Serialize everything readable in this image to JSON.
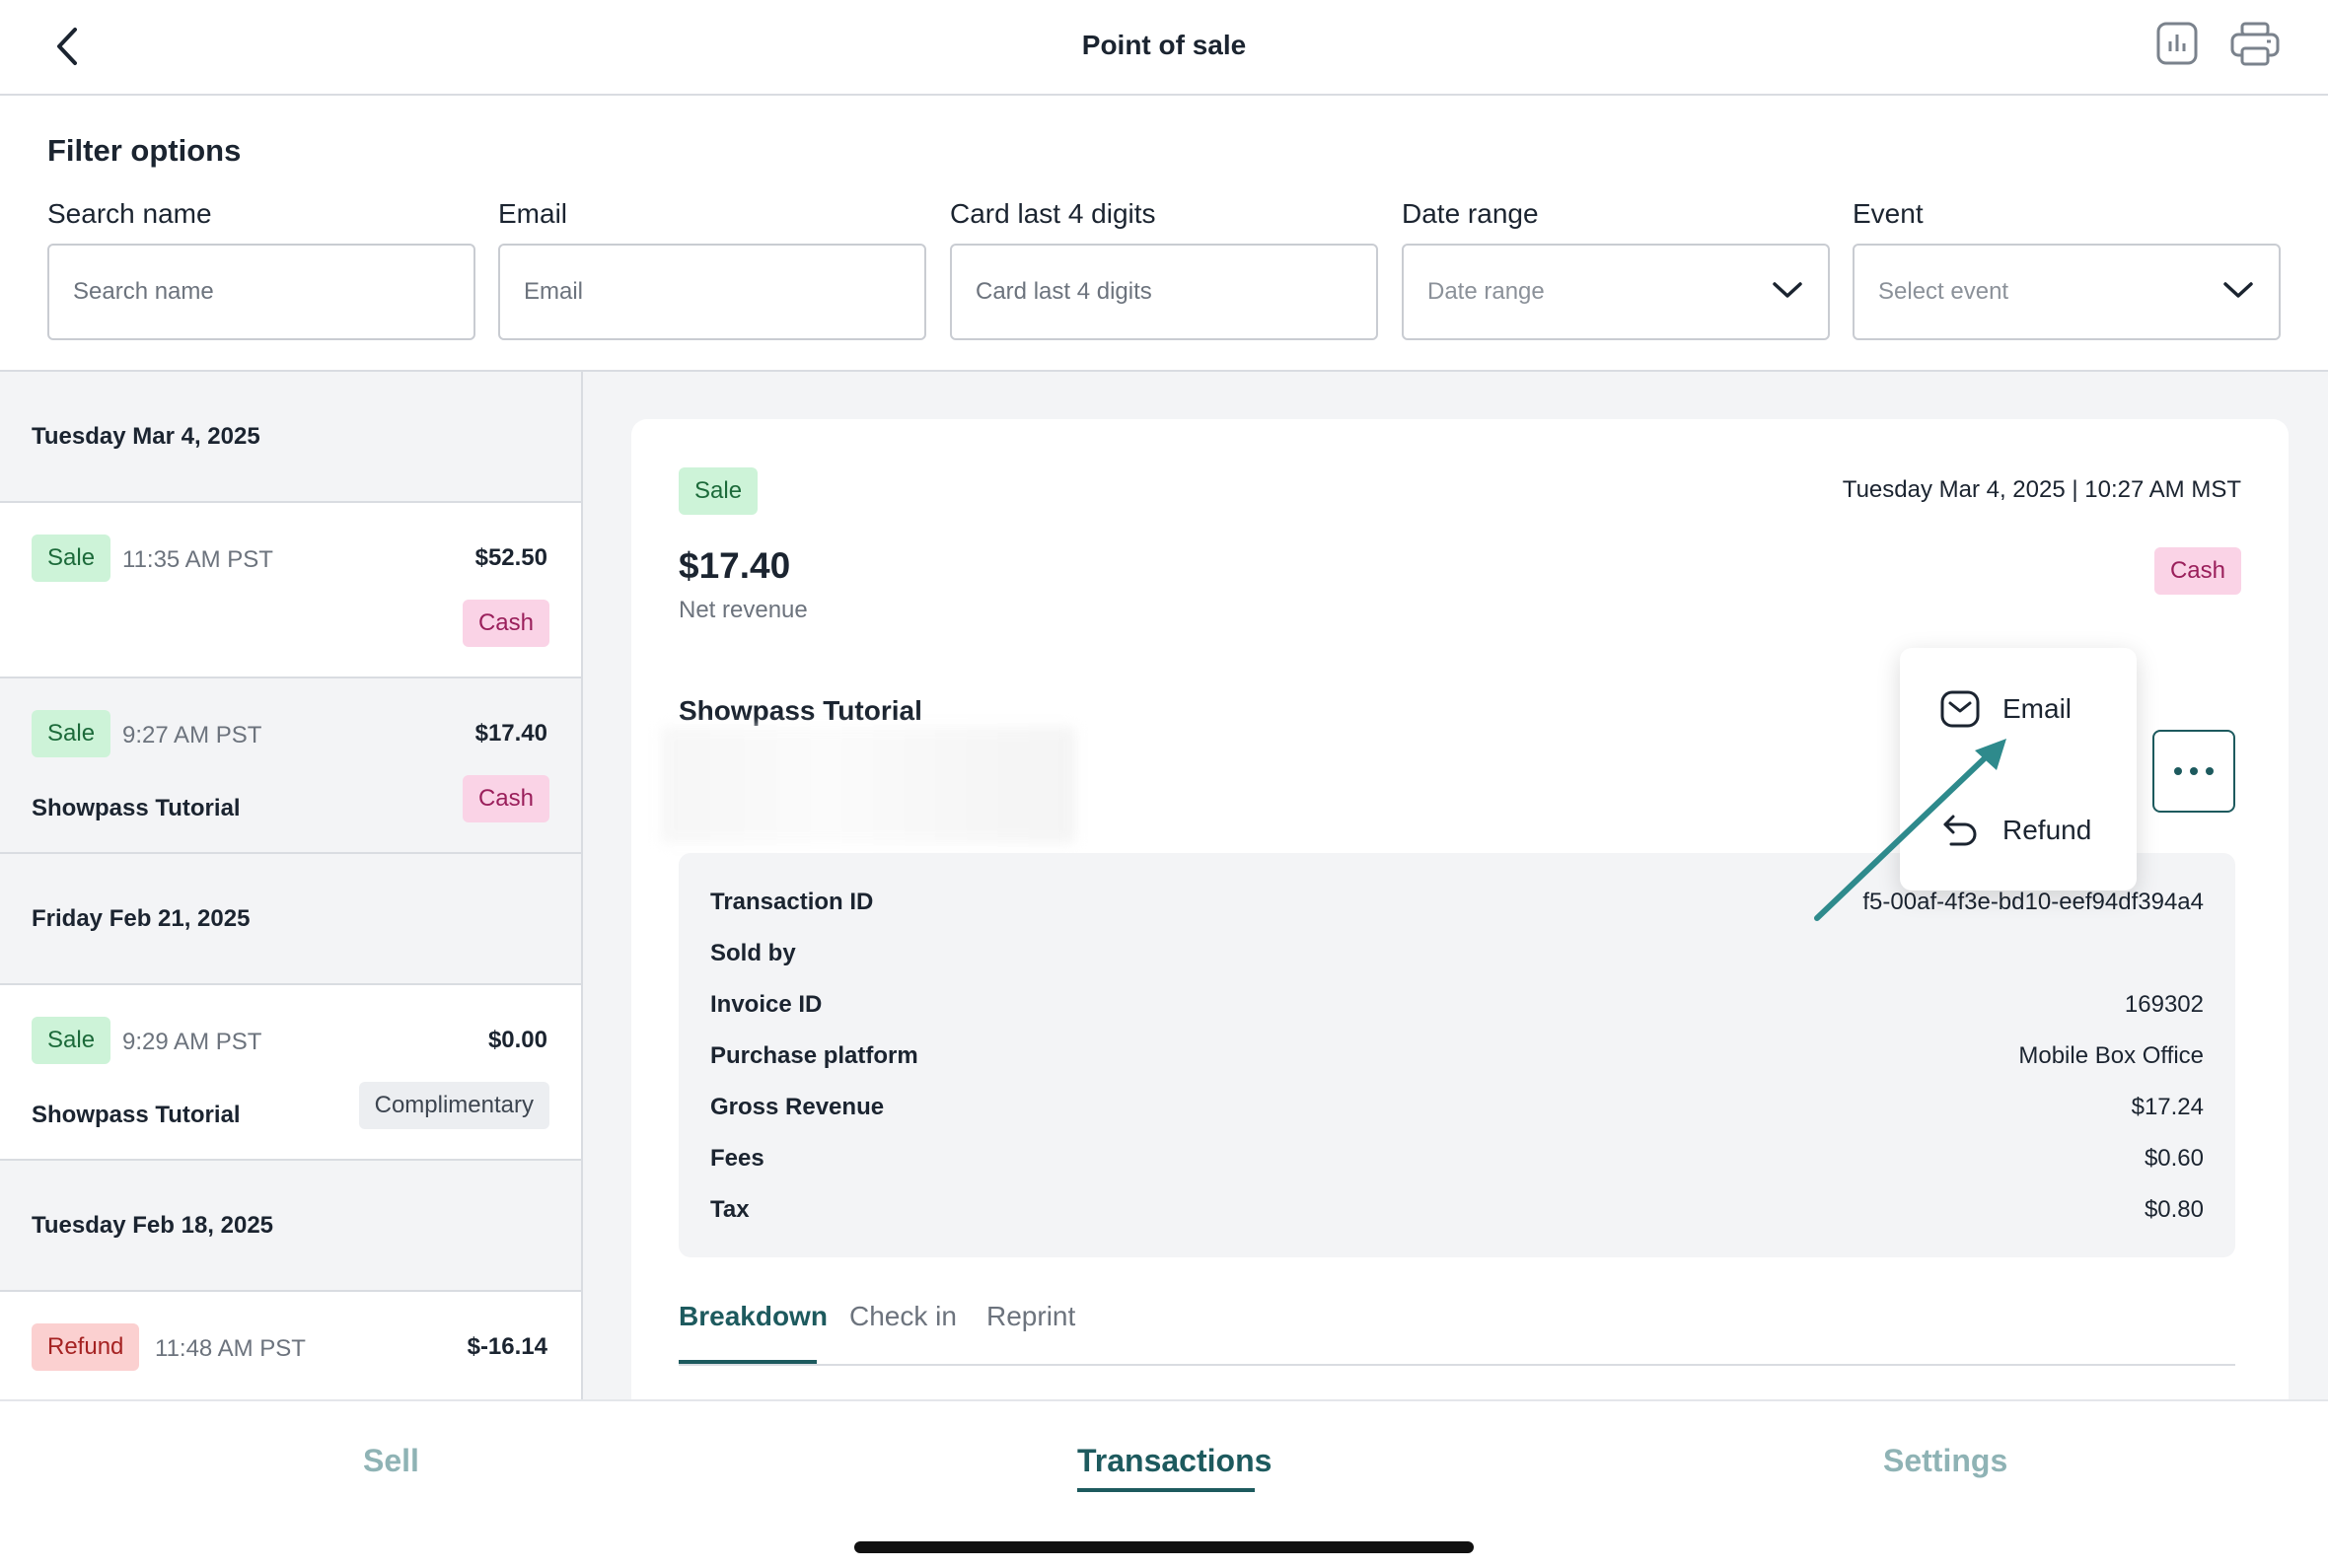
{
  "header": {
    "title": "Point of sale",
    "back_icon": "chevron-left-icon",
    "report_icon": "bar-chart-icon",
    "print_icon": "printer-icon"
  },
  "filters": {
    "title": "Filter options",
    "search_name": {
      "label": "Search name",
      "placeholder": "Search name"
    },
    "email": {
      "label": "Email",
      "placeholder": "Email"
    },
    "card": {
      "label": "Card last 4 digits",
      "placeholder": "Card last 4 digits"
    },
    "date_range": {
      "label": "Date range",
      "placeholder": "Date range"
    },
    "event": {
      "label": "Event",
      "placeholder": "Select event"
    }
  },
  "list": {
    "days": [
      {
        "date": "Tuesday Mar 4, 2025"
      },
      {
        "date": "Friday Feb 21, 2025"
      },
      {
        "date": "Tuesday Feb 18, 2025"
      }
    ],
    "transactions": [
      {
        "type": "Sale",
        "time": "11:35 AM PST",
        "amount": "$52.50",
        "name": "",
        "method": "Cash"
      },
      {
        "type": "Sale",
        "time": "9:27 AM PST",
        "amount": "$17.40",
        "name": "Showpass Tutorial",
        "method": "Cash"
      },
      {
        "type": "Sale",
        "time": "9:29 AM PST",
        "amount": "$0.00",
        "name": "Showpass Tutorial",
        "method": "Complimentary"
      },
      {
        "type": "Refund",
        "time": "11:48 AM PST",
        "amount": "$-16.14",
        "name": "",
        "method": ""
      }
    ]
  },
  "detail": {
    "type": "Sale",
    "datetime": "Tuesday Mar 4, 2025 | 10:27 AM MST",
    "amount": "$17.40",
    "amount_label": "Net revenue",
    "method": "Cash",
    "event_name": "Showpass Tutorial",
    "info": [
      {
        "key": "Transaction ID",
        "value": "f5-00af-4f3e-bd10-eef94df394a4"
      },
      {
        "key": "Sold by",
        "value": ""
      },
      {
        "key": "Invoice ID",
        "value": "169302"
      },
      {
        "key": "Purchase platform",
        "value": "Mobile Box Office"
      },
      {
        "key": "Gross Revenue",
        "value": "$17.24"
      },
      {
        "key": "Fees",
        "value": "$0.60"
      },
      {
        "key": "Tax",
        "value": "$0.80"
      }
    ],
    "tabs": [
      "Breakdown",
      "Check in",
      "Reprint"
    ]
  },
  "popover": {
    "email": "Email",
    "refund": "Refund"
  },
  "bottom_nav": {
    "sell": "Sell",
    "transactions": "Transactions",
    "settings": "Settings"
  },
  "colors": {
    "accent": "#1d5a5e",
    "sale_bg": "#cdf3d8",
    "cash_bg": "#fad3e6",
    "refund_bg": "#fbd0d0",
    "arrow": "#2e8a8c"
  }
}
